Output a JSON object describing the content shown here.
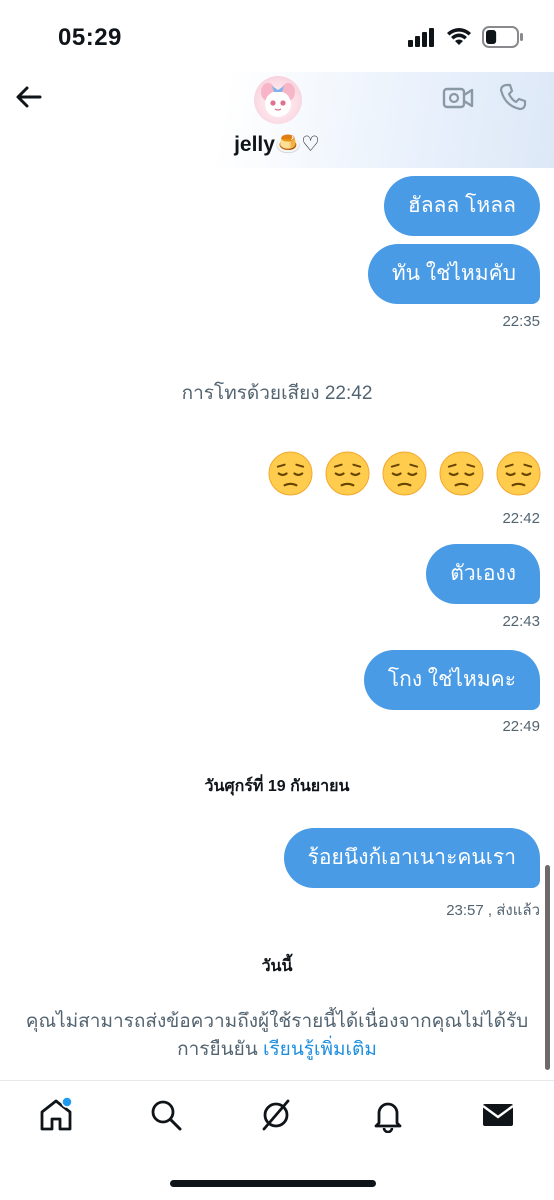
{
  "status_bar": {
    "time": "05:29",
    "battery_level": 0.35
  },
  "header": {
    "name": "jelly",
    "name_suffix": "🍮♡"
  },
  "messages": [
    {
      "text": "ฮัลลล โหลล"
    },
    {
      "text": "ทัน ใช่ไหมคับ",
      "time": "22:35"
    }
  ],
  "call_notice": "การโทรด้วยเสียง 22:42",
  "emoji_message": {
    "emojis": [
      "😔",
      "😔",
      "😔",
      "😔",
      "😔"
    ],
    "time": "22:42"
  },
  "messages2": [
    {
      "text": "ตัวเองง",
      "time": "22:43"
    },
    {
      "text": "โกง ใช่ไหมคะ",
      "time": "22:49"
    }
  ],
  "date_separator_1": "วันศุกร์ที่ 19 กันยายน",
  "message_last": {
    "text": "ร้อยนึงก้เอาเนาะคนเรา",
    "time": "23:57 , ส่งแล้ว"
  },
  "date_separator_2": "วันนี้",
  "notice": {
    "line1": "คุณไม่สามารถส่งข้อความถึงผู้ใช้รายนี้ได้เนื่องจากคุณไม่ได้รับ",
    "line2": "การยืนยัน",
    "link": "เรียนรู้เพิ่มเติม"
  },
  "tabs": [
    "home-icon",
    "search-icon",
    "grok-icon",
    "bell-icon",
    "mail-icon"
  ],
  "colors": {
    "bubble": "#4a9be6",
    "link": "#1d8fe0",
    "muted": "#536471",
    "notification_dot": "#1d9bf0"
  }
}
